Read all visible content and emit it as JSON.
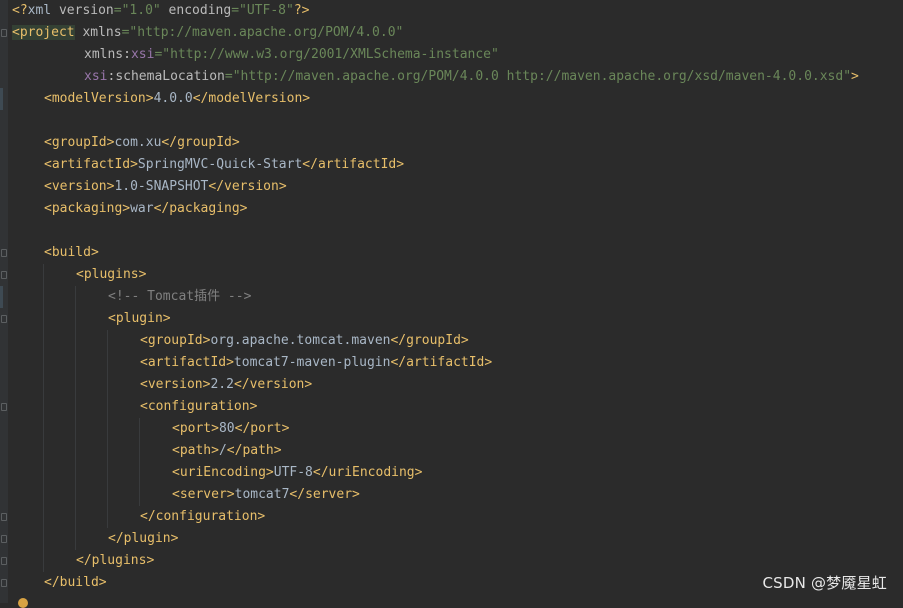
{
  "code": {
    "l1": {
      "p1": "<?",
      "t1": "xml",
      "a1": " version",
      "e1": "=",
      "v1": "\"1.0\"",
      "a2": " encoding",
      "e2": "=",
      "v2": "\"UTF-8\"",
      "p2": "?>"
    },
    "l2": {
      "t1": "<project",
      "a1": " xmlns",
      "e1": "=",
      "v1": "\"http://maven.apache.org/POM/4.0.0\""
    },
    "l3": {
      "a1": "xmlns",
      "c1": ":",
      "n1": "xsi",
      "e1": "=",
      "v1": "\"http://www.w3.org/2001/XMLSchema-instance\""
    },
    "l4": {
      "n1": "xsi",
      "c1": ":",
      "a1": "schemaLocation",
      "e1": "=",
      "v1": "\"http://maven.apache.org/POM/4.0.0 http://maven.apache.org/xsd/maven-4.0.0.xsd\"",
      "t1": ">"
    },
    "l5": {
      "o": "<modelVersion>",
      "x": "4.0.0",
      "c": "</modelVersion>"
    },
    "l7": {
      "o": "<groupId>",
      "x": "com.xu",
      "c": "</groupId>"
    },
    "l8": {
      "o": "<artifactId>",
      "x": "SpringMVC-Quick-Start",
      "c": "</artifactId>"
    },
    "l9": {
      "o": "<version>",
      "x": "1.0-SNAPSHOT",
      "c": "</version>"
    },
    "l10": {
      "o": "<packaging>",
      "x": "war",
      "c": "</packaging>"
    },
    "l12": {
      "o": "<build>"
    },
    "l13": {
      "o": "<plugins>"
    },
    "l14": {
      "cm": "<!-- Tomcat插件 -->"
    },
    "l15": {
      "o": "<plugin>"
    },
    "l16": {
      "o": "<groupId>",
      "x": "org.apache.tomcat.maven",
      "c": "</groupId>"
    },
    "l17": {
      "o": "<artifactId>",
      "x": "tomcat7-maven-plugin",
      "c": "</artifactId>"
    },
    "l18": {
      "o": "<version>",
      "x": "2.2",
      "c": "</version>"
    },
    "l19": {
      "o": "<configuration>"
    },
    "l20": {
      "o": "<port>",
      "x": "80",
      "c": "</port>"
    },
    "l21": {
      "o": "<path>",
      "x": "/",
      "c": "</path>"
    },
    "l22": {
      "o": "<uriEncoding>",
      "x": "UTF-8",
      "c": "</uriEncoding>"
    },
    "l23": {
      "o": "<server>",
      "x": "tomcat7",
      "c": "</server>"
    },
    "l24": {
      "c": "</configuration>"
    },
    "l25": {
      "c": "</plugin>"
    },
    "l26": {
      "c": "</plugins>"
    },
    "l27": {
      "c": "</build>"
    }
  },
  "watermark": "CSDN @梦魇星虹",
  "colors": {
    "background": "#2b2b2b",
    "tag": "#e8bf6a",
    "attribute": "#bababa",
    "namespace": "#9876aa",
    "string": "#6a8759",
    "text": "#a9b7c6",
    "comment": "#808080"
  },
  "icons": [
    "fold-marker-icon",
    "lightbulb-icon"
  ]
}
